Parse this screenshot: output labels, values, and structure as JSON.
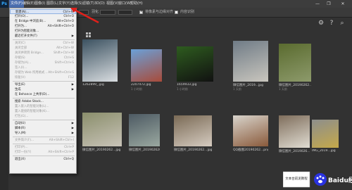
{
  "app": {
    "logo": "Ps"
  },
  "menubar": {
    "items": [
      "文件(F)",
      "编辑(E)",
      "图像(I)",
      "图层(L)",
      "文字(Y)",
      "选择(S)",
      "滤镜(T)",
      "3D(D)",
      "视图(V)",
      "窗口(W)",
      "帮助(H)"
    ],
    "window_controls": [
      "—",
      "❐",
      "✕"
    ]
  },
  "optionsbar": {
    "flow_label": "羽化",
    "checkbox1_label": "将像素与边缘对齐",
    "checkbox2_label": "内容识别"
  },
  "file_menu": [
    {
      "label": "新建(N)...",
      "shortcut": "Ctrl+N",
      "enabled": true,
      "highlight": true
    },
    {
      "label": "打开(O)...",
      "shortcut": "Ctrl+O",
      "enabled": true
    },
    {
      "label": "在 Bridge 中浏览(B)...",
      "shortcut": "Alt+Ctrl+O",
      "enabled": true
    },
    {
      "label": "打开为...",
      "shortcut": "Alt+Shift+Ctrl+O",
      "enabled": true
    },
    {
      "label": "打开为智能对象...",
      "shortcut": "",
      "enabled": true
    },
    {
      "label": "最近打开文件(T)",
      "shortcut": "",
      "enabled": true,
      "submenu": true
    },
    {
      "sep": true
    },
    {
      "label": "关闭(C)",
      "shortcut": "Ctrl+W",
      "enabled": false
    },
    {
      "label": "关闭全部",
      "shortcut": "Alt+Ctrl+W",
      "enabled": false
    },
    {
      "label": "关闭并转到 Bridge...",
      "shortcut": "Shift+Ctrl+W",
      "enabled": false
    },
    {
      "label": "存储(S)",
      "shortcut": "Ctrl+S",
      "enabled": false
    },
    {
      "label": "存储为(A)...",
      "shortcut": "Shift+Ctrl+S",
      "enabled": false
    },
    {
      "label": "签入(I)...",
      "shortcut": "",
      "enabled": false
    },
    {
      "label": "存储为 Web 所用格式...",
      "shortcut": "Alt+Shift+Ctrl+S",
      "enabled": false
    },
    {
      "label": "恢复(V)",
      "shortcut": "F12",
      "enabled": false
    },
    {
      "sep": true
    },
    {
      "label": "导出(E)",
      "shortcut": "",
      "enabled": true,
      "submenu": true
    },
    {
      "label": "生成",
      "shortcut": "",
      "enabled": true,
      "submenu": true
    },
    {
      "label": "在 Behance 上共享(D)...",
      "shortcut": "",
      "enabled": true
    },
    {
      "sep": true
    },
    {
      "label": "搜索 Adobe Stock...",
      "shortcut": "",
      "enabled": true
    },
    {
      "label": "置入嵌入的智能对象(L)...",
      "shortcut": "",
      "enabled": false
    },
    {
      "label": "置入链接的智能对象(K)...",
      "shortcut": "",
      "enabled": false
    },
    {
      "label": "打包(G)...",
      "shortcut": "",
      "enabled": false
    },
    {
      "sep": true
    },
    {
      "label": "自动(U)",
      "shortcut": "",
      "enabled": true,
      "submenu": true
    },
    {
      "label": "脚本(R)",
      "shortcut": "",
      "enabled": true,
      "submenu": true
    },
    {
      "label": "导入(M)",
      "shortcut": "",
      "enabled": true,
      "submenu": true
    },
    {
      "sep": true
    },
    {
      "label": "文件简介(F)...",
      "shortcut": "Alt+Shift+Ctrl+I",
      "enabled": false
    },
    {
      "sep": true
    },
    {
      "label": "打印(P)...",
      "shortcut": "Ctrl+P",
      "enabled": false
    },
    {
      "label": "打印一份(Y)",
      "shortcut": "Alt+Shift+Ctrl+P",
      "enabled": false
    },
    {
      "sep": true
    },
    {
      "label": "退出(X)",
      "shortcut": "Ctrl+Q",
      "enabled": true
    }
  ],
  "thumbnails": [
    {
      "name": "1262899_.jpg",
      "sub": "",
      "color": "#3b5160",
      "accent": "#d9dde0"
    },
    {
      "name": "2207472.jpg",
      "sub": "1 小时前",
      "color": "#6aa0d8",
      "accent": "#a84b3a"
    },
    {
      "name": "1659933.jpg",
      "sub": "1 小时前",
      "color": "#2e5c1f",
      "accent": "#111111"
    },
    {
      "name": "微信图片_2019...jpg",
      "sub": "1 天前",
      "color": "#6f7b86",
      "accent": "#c9c6be"
    },
    {
      "name": "微信图片_20190262...jpg",
      "sub": "1 天前",
      "color": "#5a6b2f",
      "accent": "#8d9a6b"
    },
    {
      "name": "微信图片_20190262...jpg",
      "sub": "",
      "color": "#8a8e6b",
      "accent": "#c8c3b8"
    },
    {
      "name": "微信图片_20190262024...jpg",
      "sub": "",
      "color": "#4d5a63",
      "accent": "#9aa8a0"
    },
    {
      "name": "微信图片_20190262...jpg",
      "sub": "",
      "color": "#7a6a55",
      "accent": "#d5cbc0"
    },
    {
      "name": "QQ截图20190262...png",
      "sub": "",
      "color": "#d8d4cc",
      "accent": "#8a5a3b"
    },
    {
      "name": "微信图片_2019026...jpg",
      "sub": "",
      "color": "#7f6e5c",
      "accent": "#e0dcd2"
    },
    {
      "name": "IMG_2019...jpg",
      "sub": "",
      "color": "#8d8e8c",
      "accent": "#c5a94a"
    }
  ],
  "watermark": {
    "text": "文本台前泥教程",
    "brand": "Baidu经验"
  }
}
